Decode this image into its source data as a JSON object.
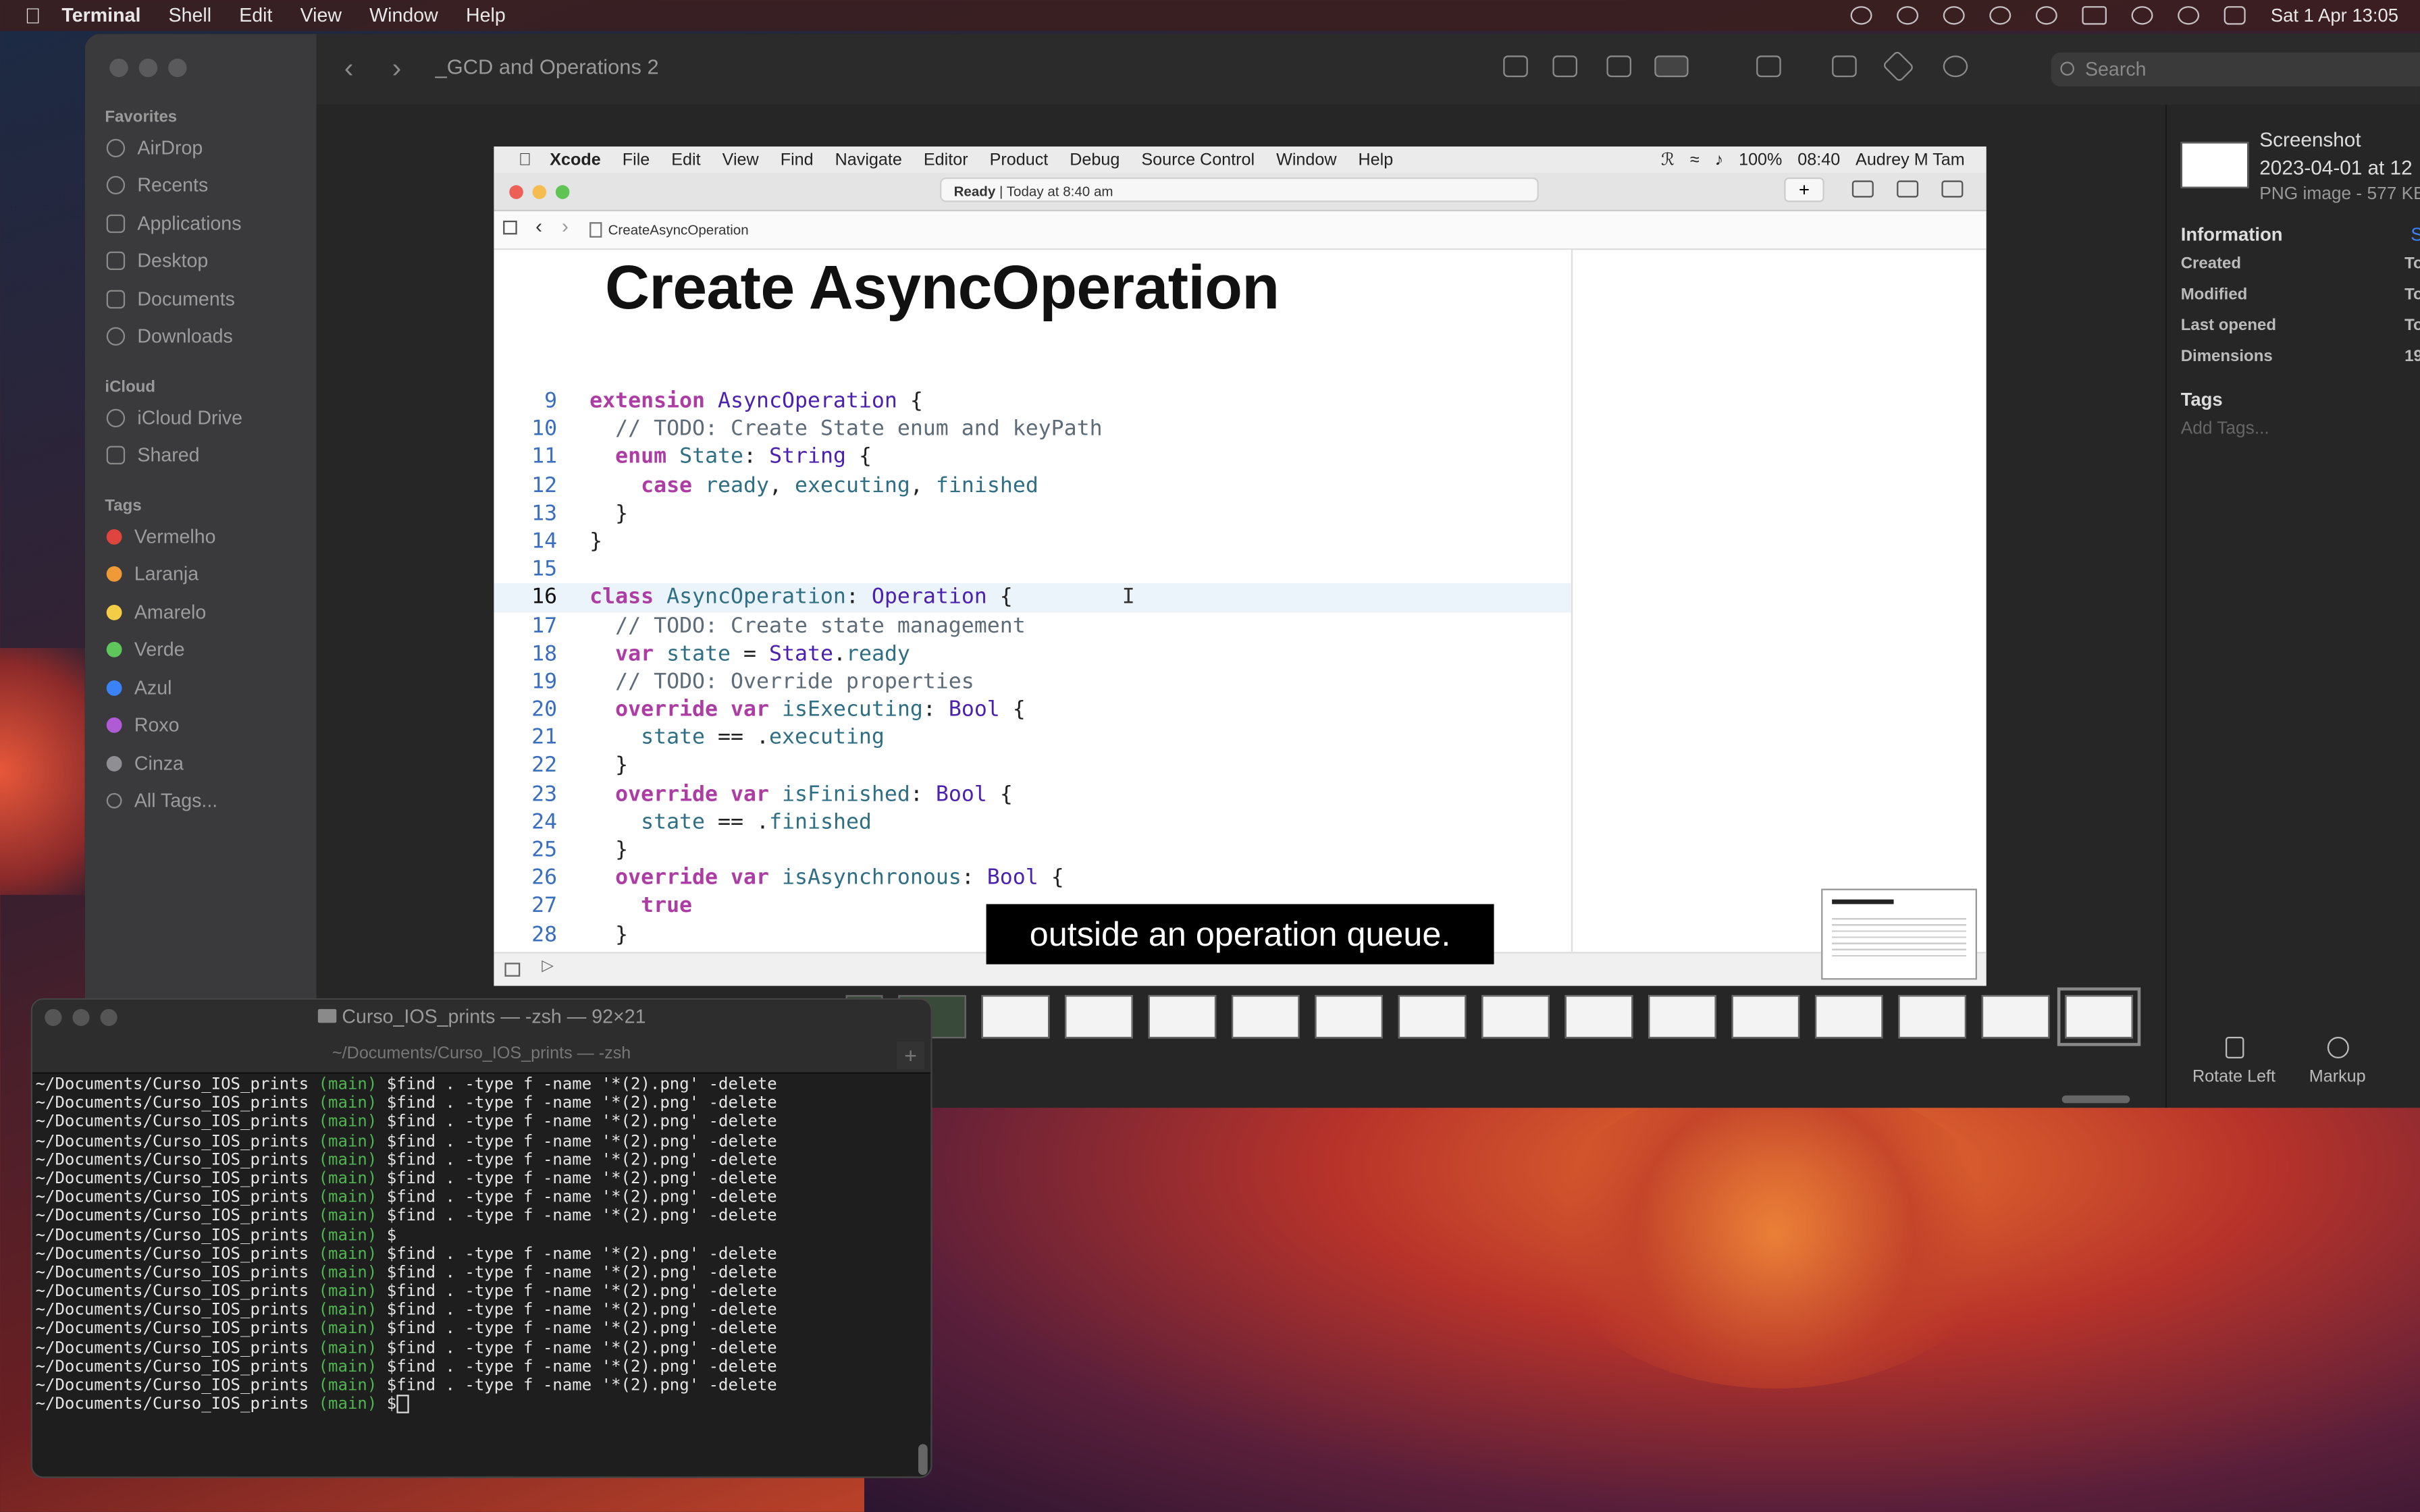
{
  "menubar": {
    "app": "Terminal",
    "items": [
      "Shell",
      "Edit",
      "View",
      "Window",
      "Help"
    ],
    "clock": "Sat 1 Apr  13:05"
  },
  "finder": {
    "title": "_GCD and Operations 2",
    "search_placeholder": "Search",
    "favorites_header": "Favorites",
    "favorites": [
      "AirDrop",
      "Recents",
      "Applications",
      "Desktop",
      "Documents",
      "Downloads"
    ],
    "icloud_header": "iCloud",
    "icloud": [
      "iCloud Drive",
      "Shared"
    ],
    "tags_header": "Tags",
    "tags": [
      {
        "name": "Vermelho",
        "color": "#e0443e"
      },
      {
        "name": "Laranja",
        "color": "#f09a37"
      },
      {
        "name": "Amarelo",
        "color": "#f5cc45"
      },
      {
        "name": "Verde",
        "color": "#5ec65b"
      },
      {
        "name": "Azul",
        "color": "#3a82f6"
      },
      {
        "name": "Roxo",
        "color": "#b15ad6"
      },
      {
        "name": "Cinza",
        "color": "#8e8e93"
      }
    ],
    "all_tags": "All Tags..."
  },
  "inspector": {
    "name_line1": "Screenshot",
    "name_line2": "2023-04-01 at 12",
    "subtitle": "PNG image - 577 KB",
    "info_header": "Information",
    "info_link": "S",
    "rows": [
      {
        "label": "Created",
        "value": "To"
      },
      {
        "label": "Modified",
        "value": "To"
      },
      {
        "label": "Last opened",
        "value": "To"
      },
      {
        "label": "Dimensions",
        "value": "19"
      }
    ],
    "tags_header": "Tags",
    "tags_placeholder": "Add Tags...",
    "rotate_left": "Rotate Left",
    "markup": "Markup"
  },
  "xcode": {
    "menubar": {
      "app": "Xcode",
      "items": [
        "File",
        "Edit",
        "View",
        "Find",
        "Navigate",
        "Editor",
        "Product",
        "Debug",
        "Source Control",
        "Window",
        "Help"
      ],
      "battery": "100%",
      "time": "08:40",
      "user": "Audrey M Tam"
    },
    "status_bold": "Ready",
    "status_rest": " | Today at 8:40 am",
    "breadcrumb": "CreateAsyncOperation",
    "slide_title": "Create AsyncOperation",
    "caption": "outside an operation queue."
  },
  "terminal": {
    "title": "Curso_IOS_prints — -zsh — 92×21",
    "subtitle": "~/Documents/Curso_IOS_prints — -zsh",
    "prompt_path": "~/Documents/Curso_IOS_prints",
    "branch": "(main)",
    "command": "$find . -type f -name '*(2).png' -delete",
    "empty_prompt": "$",
    "final_prompt": "$"
  }
}
